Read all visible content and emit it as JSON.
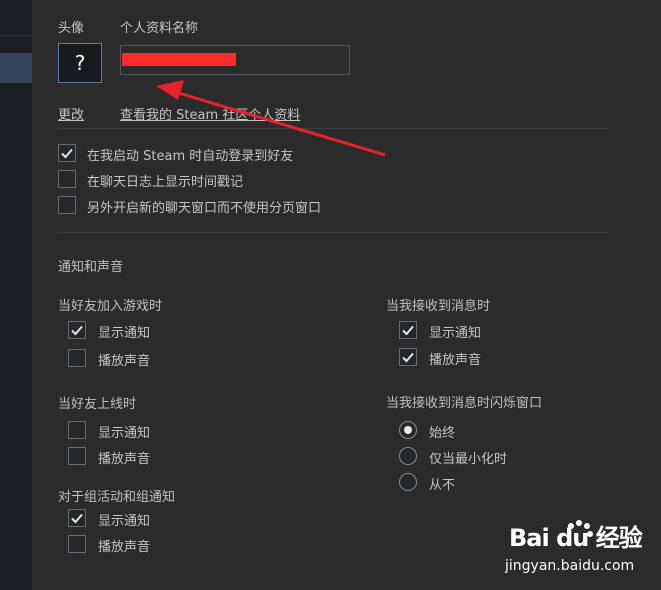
{
  "profile": {
    "avatar_label": "头像",
    "avatar_placeholder": "?",
    "name_label": "个人资料名称",
    "change_link": "更改",
    "view_profile_link": "查看我的 Steam 社区个人资料"
  },
  "general_options": [
    {
      "label": "在我启动 Steam 时自动登录到好友",
      "checked": true
    },
    {
      "label": "在聊天日志上显示时间戳记",
      "checked": false
    },
    {
      "label": "另外开启新的聊天窗口而不使用分页窗口",
      "checked": false
    }
  ],
  "notifications": {
    "heading": "通知和声音",
    "friend_joins_game": {
      "title": "当好友加入游戏时",
      "show_notification": {
        "label": "显示通知",
        "checked": true
      },
      "play_sound": {
        "label": "播放声音",
        "checked": false
      }
    },
    "friend_online": {
      "title": "当好友上线时",
      "show_notification": {
        "label": "显示通知",
        "checked": false
      },
      "play_sound": {
        "label": "播放声音",
        "checked": false
      }
    },
    "group_events": {
      "title": "对于组活动和组通知",
      "show_notification": {
        "label": "显示通知",
        "checked": true
      },
      "play_sound": {
        "label": "播放声音",
        "checked": false
      }
    },
    "message_received": {
      "title": "当我接收到消息时",
      "show_notification": {
        "label": "显示通知",
        "checked": true
      },
      "play_sound": {
        "label": "播放声音",
        "checked": true
      }
    },
    "flash_window": {
      "title": "当我接收到消息时闪烁窗口",
      "options": [
        {
          "label": "始终",
          "selected": true
        },
        {
          "label": "仅当最小化时",
          "selected": false
        },
        {
          "label": "从不",
          "selected": false
        }
      ]
    }
  },
  "watermark": {
    "brand": "Bai du 经验",
    "url": "jingyan.baidu.com"
  },
  "colors": {
    "background": "#2b2b2b",
    "sidebar": "#1d1e21",
    "sidebar_selected": "#32435a",
    "text": "#c6c6c6",
    "redaction": "#ff2a2a",
    "annotation_arrow": "#e8222a"
  },
  "icons": {
    "check": "check-icon",
    "radio": "radio-dot-icon",
    "arrow": "annotation-arrow-icon"
  }
}
